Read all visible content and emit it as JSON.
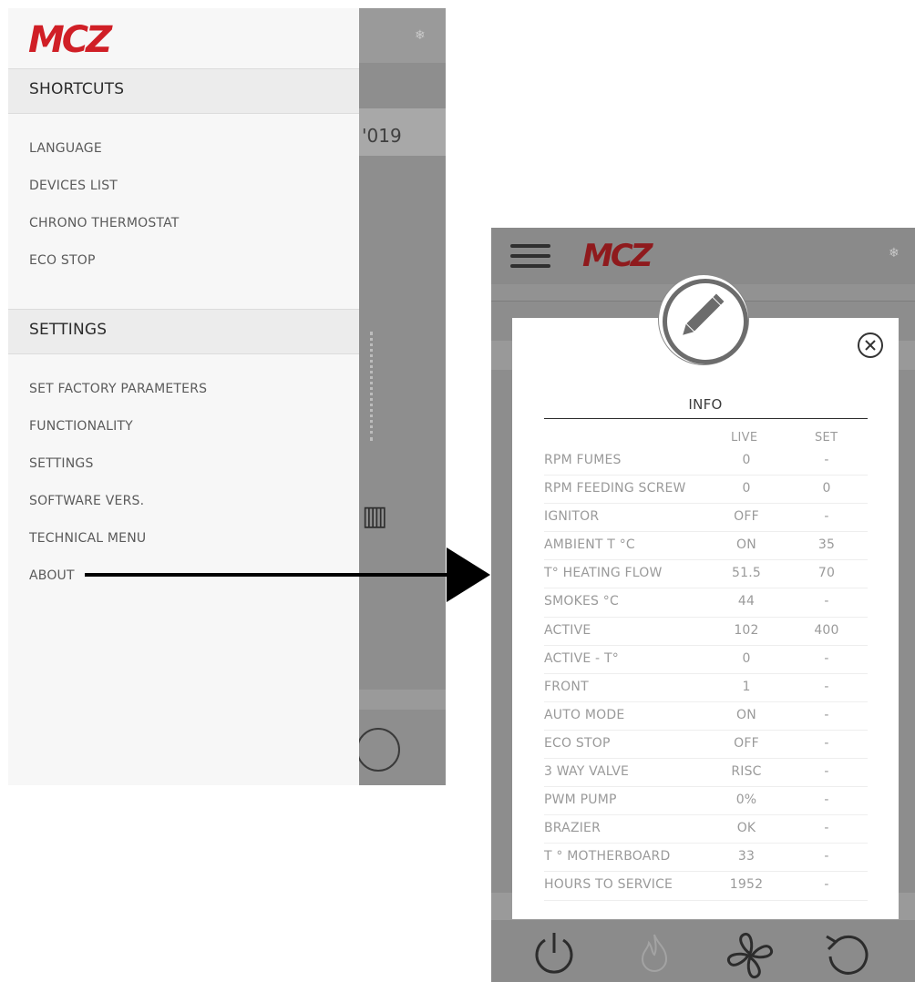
{
  "left_screen": {
    "logo": "MCZ",
    "background_year_fragment": "'019",
    "sections": [
      {
        "title": "SHORTCUTS",
        "items": [
          "LANGUAGE",
          "DEVICES LIST",
          "CHRONO THERMOSTAT",
          "ECO STOP"
        ]
      },
      {
        "title": "SETTINGS",
        "items": [
          "SET FACTORY PARAMETERS",
          "FUNCTIONALITY",
          "SETTINGS",
          "SOFTWARE VERS.",
          "TECHNICAL MENU",
          "ABOUT"
        ]
      }
    ]
  },
  "right_screen": {
    "logo": "MCZ",
    "modal": {
      "title": "INFO",
      "columns": {
        "live": "LIVE",
        "set": "SET"
      },
      "rows": [
        {
          "param": "RPM FUMES",
          "live": "0",
          "set": "-"
        },
        {
          "param": "RPM FEEDING SCREW",
          "live": "0",
          "set": "0"
        },
        {
          "param": "IGNITOR",
          "live": "OFF",
          "set": "-"
        },
        {
          "param": "AMBIENT T °C",
          "live": "ON",
          "set": "35"
        },
        {
          "param": "T° HEATING FLOW",
          "live": "51.5",
          "set": "70"
        },
        {
          "param": "SMOKES °C",
          "live": "44",
          "set": "-"
        },
        {
          "param": "ACTIVE",
          "live": "102",
          "set": "400"
        },
        {
          "param": "ACTIVE - T°",
          "live": "0",
          "set": "-"
        },
        {
          "param": "FRONT",
          "live": "1",
          "set": "-"
        },
        {
          "param": "AUTO MODE",
          "live": "ON",
          "set": "-"
        },
        {
          "param": "ECO STOP",
          "live": "OFF",
          "set": "-"
        },
        {
          "param": "3 WAY VALVE",
          "live": "RISC",
          "set": "-"
        },
        {
          "param": "PWM PUMP",
          "live": "0%",
          "set": "-"
        },
        {
          "param": "BRAZIER",
          "live": "OK",
          "set": "-"
        },
        {
          "param": "T ° MOTHERBOARD",
          "live": "33",
          "set": "-"
        },
        {
          "param": "HOURS TO SERVICE",
          "live": "1952",
          "set": "-"
        }
      ]
    }
  },
  "colors": {
    "brand_red": "#d01f26",
    "overlay_gray": "#8d8d8d",
    "drawer_bg": "#f7f7f7"
  },
  "icons": [
    "snowflake-icon",
    "hamburger-icon",
    "pencil-icon",
    "close-circle-icon",
    "power-icon",
    "flame-icon",
    "fan-icon",
    "refresh-icon"
  ]
}
